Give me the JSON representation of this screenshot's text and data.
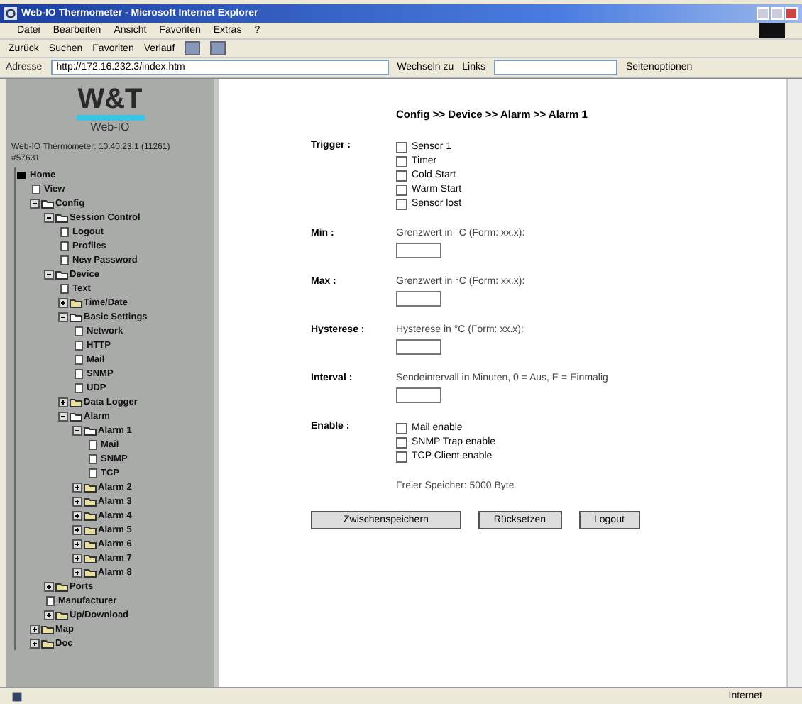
{
  "window": {
    "title": "Web-IO Thermometer - Microsoft Internet Explorer"
  },
  "menu": [
    "Datei",
    "Bearbeiten",
    "Ansicht",
    "Favoriten",
    "Extras",
    "?"
  ],
  "toolbar": [
    "Zurück",
    "Suchen",
    "Favoriten",
    "Verlauf"
  ],
  "address_bar": {
    "label": "Adresse",
    "value": "http://172.16.232.3/index.htm",
    "go": "Wechseln zu",
    "links": "Links",
    "search_button": "Seitenoptionen"
  },
  "sidebar": {
    "logo": "W&T",
    "product": "Web-IO",
    "device_info": "Web-IO Thermometer: 10.40.23.1 (11261)",
    "device_id": "#57631",
    "tree": [
      {
        "label": "Home",
        "kind": "root",
        "children": [
          {
            "label": "View",
            "kind": "page"
          },
          {
            "label": "Config",
            "kind": "folder",
            "expanded": true,
            "children": [
              {
                "label": "Session Control",
                "kind": "folder",
                "expanded": true,
                "children": [
                  {
                    "label": "Logout",
                    "kind": "page"
                  },
                  {
                    "label": "Profiles",
                    "kind": "page"
                  },
                  {
                    "label": "New Password",
                    "kind": "page"
                  }
                ]
              },
              {
                "label": "Device",
                "kind": "folder",
                "expanded": true,
                "children": [
                  {
                    "label": "Text",
                    "kind": "page"
                  },
                  {
                    "label": "Time/Date",
                    "kind": "folder",
                    "expanded": false
                  },
                  {
                    "label": "Basic Settings",
                    "kind": "folder",
                    "expanded": true,
                    "children": [
                      {
                        "label": "Network",
                        "kind": "page"
                      },
                      {
                        "label": "HTTP",
                        "kind": "page"
                      },
                      {
                        "label": "Mail",
                        "kind": "page"
                      },
                      {
                        "label": "SNMP",
                        "kind": "page"
                      },
                      {
                        "label": "UDP",
                        "kind": "page"
                      }
                    ]
                  },
                  {
                    "label": "Data Logger",
                    "kind": "folder",
                    "expanded": false
                  },
                  {
                    "label": "Alarm",
                    "kind": "folder",
                    "expanded": true,
                    "children": [
                      {
                        "label": "Alarm 1",
                        "kind": "folder",
                        "expanded": true,
                        "children": [
                          {
                            "label": "Mail",
                            "kind": "page"
                          },
                          {
                            "label": "SNMP",
                            "kind": "page"
                          },
                          {
                            "label": "TCP",
                            "kind": "page"
                          }
                        ]
                      },
                      {
                        "label": "Alarm 2",
                        "kind": "folder",
                        "expanded": false
                      },
                      {
                        "label": "Alarm 3",
                        "kind": "folder",
                        "expanded": false
                      },
                      {
                        "label": "Alarm 4",
                        "kind": "folder",
                        "expanded": false
                      },
                      {
                        "label": "Alarm 5",
                        "kind": "folder",
                        "expanded": false
                      },
                      {
                        "label": "Alarm 6",
                        "kind": "folder",
                        "expanded": false
                      },
                      {
                        "label": "Alarm 7",
                        "kind": "folder",
                        "expanded": false
                      },
                      {
                        "label": "Alarm 8",
                        "kind": "folder",
                        "expanded": false
                      }
                    ]
                  }
                ]
              },
              {
                "label": "Ports",
                "kind": "folder",
                "expanded": false
              },
              {
                "label": "Manufacturer",
                "kind": "page"
              },
              {
                "label": "Up/Download",
                "kind": "folder",
                "expanded": false
              }
            ]
          },
          {
            "label": "Map",
            "kind": "folder",
            "expanded": false
          },
          {
            "label": "Doc",
            "kind": "folder",
            "expanded": false
          }
        ]
      }
    ]
  },
  "form": {
    "breadcrumb": "Config >> Device >> Alarm >> Alarm 1",
    "sections": [
      {
        "kind": "checks",
        "label": "Trigger :",
        "options": [
          {
            "label": "Sensor 1",
            "checked": false
          },
          {
            "label": "Timer",
            "checked": false
          },
          {
            "label": "Cold Start",
            "checked": false
          },
          {
            "label": "Warm Start",
            "checked": false
          },
          {
            "label": "Sensor lost",
            "checked": false
          }
        ]
      },
      {
        "kind": "input",
        "label": "Min :",
        "hint": "Grenzwert in °C (Form: xx.x):"
      },
      {
        "kind": "input",
        "label": "Max :",
        "hint": "Grenzwert in °C (Form: xx.x):"
      },
      {
        "kind": "input",
        "label": "Hysterese :",
        "hint": "Hysterese in °C (Form: xx.x):"
      },
      {
        "kind": "input",
        "label": "Interval :",
        "hint": "Sendeintervall in Minuten, 0 = Aus, E = Einmalig"
      },
      {
        "kind": "checks",
        "label": "Enable :",
        "options": [
          {
            "label": "Mail enable",
            "checked": false
          },
          {
            "label": "SNMP Trap enable",
            "checked": false
          },
          {
            "label": "TCP Client enable",
            "checked": false
          }
        ]
      }
    ],
    "free_memory": "Freier Speicher: 5000 Byte",
    "buttons": [
      "Zwischenspeichern",
      "Rücksetzen",
      "Logout"
    ]
  },
  "status_bar": {
    "zone": "Internet"
  }
}
